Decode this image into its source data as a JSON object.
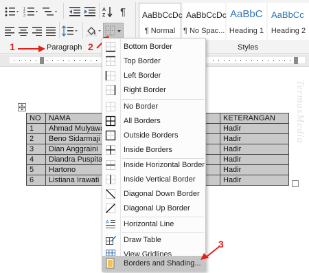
{
  "ribbon": {
    "paragraph_label": "Paragraph",
    "styles_label": "Styles",
    "pilcrow": "¶",
    "styles": [
      {
        "preview": "AaBbCcDc",
        "name": "¶ Normal"
      },
      {
        "preview": "AaBbCcDc",
        "name": "¶ No Spac..."
      },
      {
        "preview": "AaBbC",
        "name": "Heading 1"
      },
      {
        "preview": "AaBbCc",
        "name": "Heading 2"
      }
    ]
  },
  "callouts": {
    "one": "1",
    "two": "2",
    "three": "3"
  },
  "watermark": "TermasMedia",
  "table": {
    "headers": [
      "NO",
      "NAMA",
      "KETERANGAN"
    ],
    "rows": [
      [
        "1",
        "Ahmad Mulyawan",
        "Hadir"
      ],
      [
        "2",
        "Beno Sidarmaji",
        "Hadir"
      ],
      [
        "3",
        "Dian Anggraini",
        "Hadir"
      ],
      [
        "4",
        "Diandra Puspita",
        "Hadir"
      ],
      [
        "5",
        "Hartono",
        "Hadir"
      ],
      [
        "6",
        "Listiana Irawati",
        "Hadir"
      ]
    ]
  },
  "menu": {
    "items": [
      {
        "label": "Bottom Border",
        "icon": "bottom-border-icon"
      },
      {
        "label": "Top Border",
        "icon": "top-border-icon"
      },
      {
        "label": "Left Border",
        "icon": "left-border-icon"
      },
      {
        "label": "Right Border",
        "icon": "right-border-icon"
      },
      {
        "label": "No Border",
        "icon": "no-border-icon"
      },
      {
        "label": "All Borders",
        "icon": "all-borders-icon"
      },
      {
        "label": "Outside Borders",
        "icon": "outside-borders-icon"
      },
      {
        "label": "Inside Borders",
        "icon": "inside-borders-icon"
      },
      {
        "label": "Inside Horizontal Border",
        "icon": "inside-horizontal-border-icon"
      },
      {
        "label": "Inside Vertical Border",
        "icon": "inside-vertical-border-icon"
      },
      {
        "label": "Diagonal Down Border",
        "icon": "diagonal-down-border-icon"
      },
      {
        "label": "Diagonal Up Border",
        "icon": "diagonal-up-border-icon"
      },
      {
        "label": "Horizontal Line",
        "icon": "horizontal-line-icon"
      },
      {
        "label": "Draw Table",
        "icon": "draw-table-icon"
      },
      {
        "label": "View Gridlines",
        "icon": "view-gridlines-icon"
      },
      {
        "label": "Borders and Shading...",
        "icon": "borders-and-shading-icon"
      }
    ]
  },
  "colors": {
    "callout": "#e0201a",
    "highlight": "#c5c5c5",
    "heading": "#2e74b5"
  }
}
